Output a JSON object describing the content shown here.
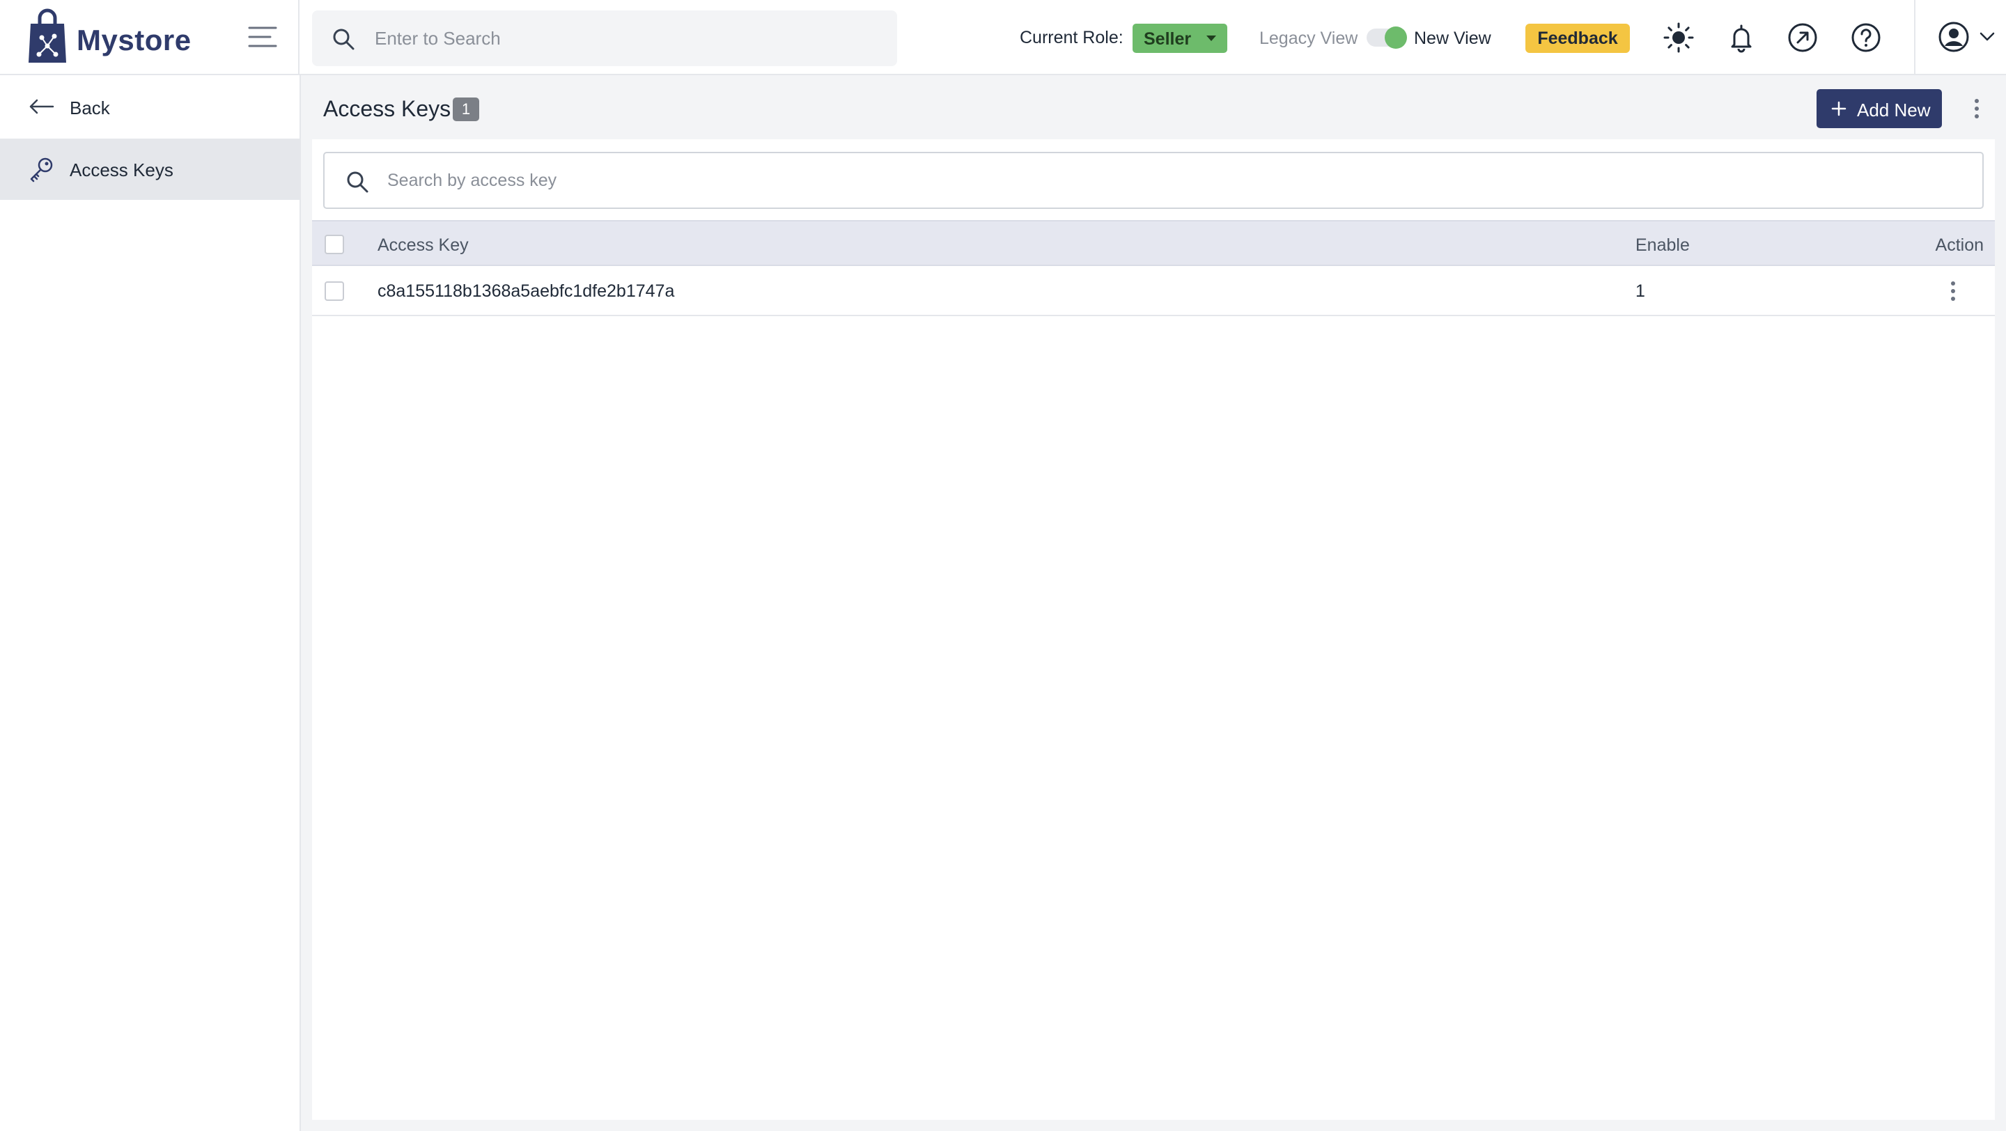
{
  "brand": {
    "name": "Mystore"
  },
  "header": {
    "search_placeholder": "Enter to Search",
    "role_label": "Current Role:",
    "role_value": "Seller",
    "legacy_view_label": "Legacy View",
    "new_view_label": "New View",
    "feedback_label": "Feedback"
  },
  "sidebar": {
    "back_label": "Back",
    "items": [
      {
        "label": "Access Keys",
        "icon": "key-icon",
        "active": true
      }
    ]
  },
  "page": {
    "title": "Access Keys",
    "count": "1",
    "add_label": "Add New",
    "search_placeholder": "Search by access key"
  },
  "table": {
    "columns": {
      "key": "Access Key",
      "enable": "Enable",
      "action": "Action"
    },
    "rows": [
      {
        "key": "c8a155118b1368a5aebfc1dfe2b1747a",
        "enable": "1"
      }
    ]
  },
  "colors": {
    "brand": "#2f3b6b",
    "role_badge": "#6dbb6b",
    "feedback": "#f4c542",
    "toggle_on": "#6dbb6b"
  }
}
